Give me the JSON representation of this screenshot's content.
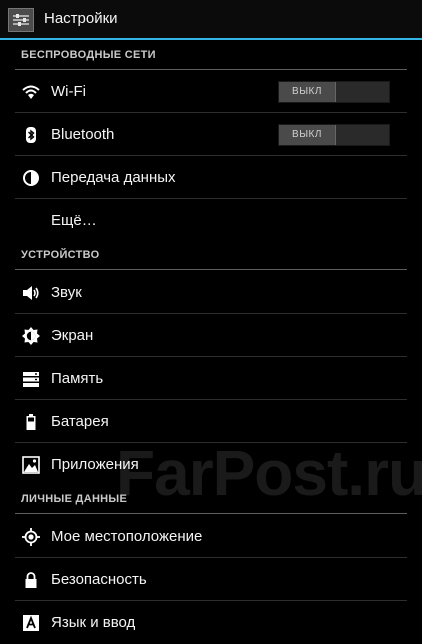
{
  "header": {
    "title": "Настройки",
    "icon": "settings-app-icon"
  },
  "colors": {
    "accent": "#33b5e5",
    "background": "#000000"
  },
  "sections": [
    {
      "title": "БЕСПРОВОДНЫЕ СЕТИ",
      "items": [
        {
          "label": "Wi-Fi",
          "icon": "wifi-icon",
          "toggle": "ВЫКЛ"
        },
        {
          "label": "Bluetooth",
          "icon": "bluetooth-icon",
          "toggle": "ВЫКЛ"
        },
        {
          "label": "Передача данных",
          "icon": "data-usage-icon"
        },
        {
          "label": "Ещё…",
          "icon": ""
        }
      ]
    },
    {
      "title": "УСТРОЙСТВО",
      "items": [
        {
          "label": "Звук",
          "icon": "sound-icon"
        },
        {
          "label": "Экран",
          "icon": "display-icon"
        },
        {
          "label": "Память",
          "icon": "storage-icon"
        },
        {
          "label": "Батарея",
          "icon": "battery-icon"
        },
        {
          "label": "Приложения",
          "icon": "apps-icon"
        }
      ]
    },
    {
      "title": "ЛИЧНЫЕ ДАННЫЕ",
      "items": [
        {
          "label": "Мое местоположение",
          "icon": "location-icon"
        },
        {
          "label": "Безопасность",
          "icon": "lock-icon"
        },
        {
          "label": "Язык и ввод",
          "icon": "language-icon"
        }
      ]
    }
  ],
  "watermark": "FarPost.ru"
}
